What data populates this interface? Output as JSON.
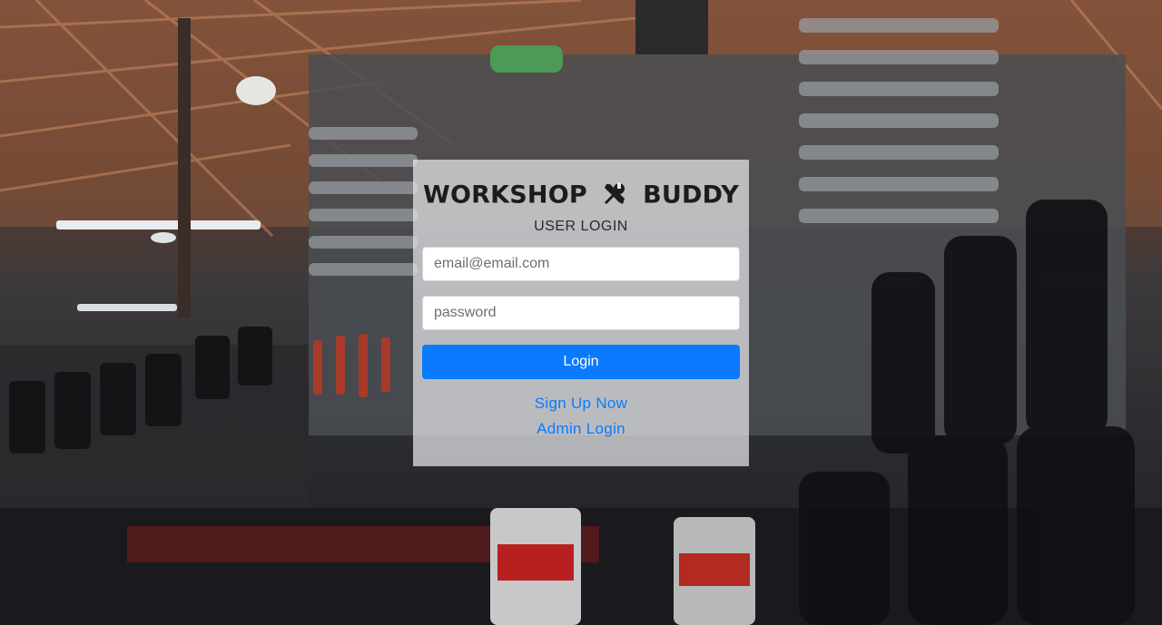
{
  "brand": {
    "left": "WORKSHOP",
    "right": "BUDDY",
    "icon": "wrench-screwdriver-icon"
  },
  "login": {
    "subtitle": "USER LOGIN",
    "email_placeholder": "email@email.com",
    "password_placeholder": "password",
    "submit_label": "Login"
  },
  "links": {
    "signup": "Sign Up Now",
    "admin": "Admin Login"
  },
  "colors": {
    "accent": "#0a7bff",
    "panel": "#e8e8ec"
  }
}
